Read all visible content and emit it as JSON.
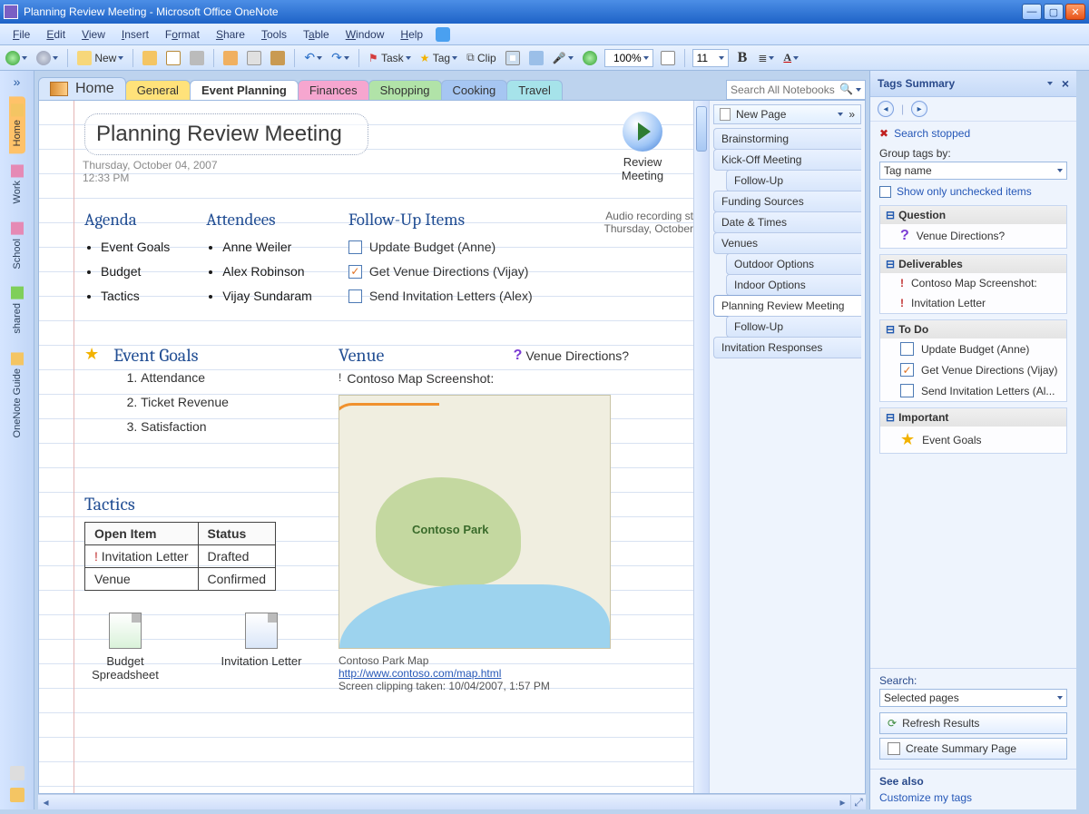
{
  "window": {
    "title": "Planning Review Meeting - Microsoft Office OneNote"
  },
  "menubar": [
    "File",
    "Edit",
    "View",
    "Insert",
    "Format",
    "Share",
    "Tools",
    "Table",
    "Window",
    "Help"
  ],
  "toolbar": {
    "back_label": "",
    "new_label": "New",
    "task_label": "Task",
    "tag_label": "Tag",
    "clip_label": "Clip",
    "zoom": "100%",
    "font_size": "11"
  },
  "notebook": {
    "home": "Home",
    "search_placeholder": "Search All Notebooks",
    "sections": [
      {
        "label": "General",
        "cls": "general"
      },
      {
        "label": "Event Planning",
        "active": true
      },
      {
        "label": "Finances",
        "cls": "finances"
      },
      {
        "label": "Shopping",
        "cls": "shopping"
      },
      {
        "label": "Cooking",
        "cls": "cooking"
      },
      {
        "label": "Travel",
        "cls": "travel"
      }
    ]
  },
  "left_tabs": [
    "Home",
    "Work",
    "School",
    "shared",
    "OneNote Guide"
  ],
  "page": {
    "title": "Planning Review Meeting",
    "date": "Thursday, October 04, 2007",
    "time": "12:33 PM",
    "review_label": "Review Meeting",
    "audio_line1": "Audio recording st",
    "audio_line2": "Thursday, October",
    "agenda_h": "Agenda",
    "agenda": [
      "Event Goals",
      "Budget",
      "Tactics"
    ],
    "attendees_h": "Attendees",
    "attendees": [
      "Anne Weiler",
      "Alex Robinson",
      "Vijay Sundaram"
    ],
    "followup_h": "Follow-Up Items",
    "followup": [
      {
        "label": "Update Budget (Anne)",
        "checked": false
      },
      {
        "label": "Get Venue Directions (Vijay)",
        "checked": true
      },
      {
        "label": "Send Invitation Letters (Alex)",
        "checked": false
      }
    ],
    "goals_h": "Event Goals",
    "goals": [
      "Attendance",
      "Ticket Revenue",
      "Satisfaction"
    ],
    "venue_h": "Venue",
    "venue_q": "Venue Directions?",
    "venue_caption": "Contoso Map Screenshot:",
    "map_label": "Contoso Park",
    "map_name": "Contoso Park Map",
    "map_url": "http://www.contoso.com/map.html",
    "map_clip": "Screen clipping taken: 10/04/2007, 1:57 PM",
    "tactics_h": "Tactics",
    "tactics_head": [
      "Open Item",
      "Status"
    ],
    "tactics_rows": [
      [
        "Invitation Letter",
        "Drafted"
      ],
      [
        "Venue",
        "Confirmed"
      ]
    ],
    "attach": [
      {
        "label": "Budget Spreadsheet",
        "type": "xls"
      },
      {
        "label": "Invitation Letter",
        "type": "doc"
      }
    ]
  },
  "page_tabs": {
    "new": "New Page",
    "items": [
      {
        "label": "Brainstorming"
      },
      {
        "label": "Kick-Off Meeting"
      },
      {
        "label": "Follow-Up",
        "indent": true
      },
      {
        "label": "Funding Sources"
      },
      {
        "label": "Date & Times"
      },
      {
        "label": "Venues"
      },
      {
        "label": "Outdoor Options",
        "indent": true
      },
      {
        "label": "Indoor Options",
        "indent": true
      },
      {
        "label": "Planning Review Meeting",
        "active": true
      },
      {
        "label": "Follow-Up",
        "indent": true
      },
      {
        "label": "Invitation Responses"
      }
    ]
  },
  "pane": {
    "title": "Tags Summary",
    "search_status": "Search stopped",
    "group_label": "Group tags by:",
    "group_value": "Tag name",
    "show_unchecked": "Show only unchecked items",
    "groups": [
      {
        "name": "Question",
        "items": [
          {
            "icon": "q",
            "label": "Venue Directions?"
          }
        ]
      },
      {
        "name": "Deliverables",
        "items": [
          {
            "icon": "important",
            "label": "Contoso Map Screenshot:"
          },
          {
            "icon": "important",
            "label": "Invitation Letter"
          }
        ]
      },
      {
        "name": "To Do",
        "items": [
          {
            "icon": "cb",
            "checked": false,
            "label": "Update Budget (Anne)"
          },
          {
            "icon": "cb",
            "checked": true,
            "label": "Get Venue Directions (Vijay)"
          },
          {
            "icon": "cb",
            "checked": false,
            "label": "Send Invitation Letters (Al..."
          }
        ]
      },
      {
        "name": "Important",
        "items": [
          {
            "icon": "star",
            "label": "Event Goals"
          }
        ]
      }
    ],
    "search_label": "Search:",
    "search_scope": "Selected pages",
    "refresh": "Refresh Results",
    "summary": "Create Summary Page",
    "see_also": "See also",
    "customize": "Customize my tags"
  }
}
